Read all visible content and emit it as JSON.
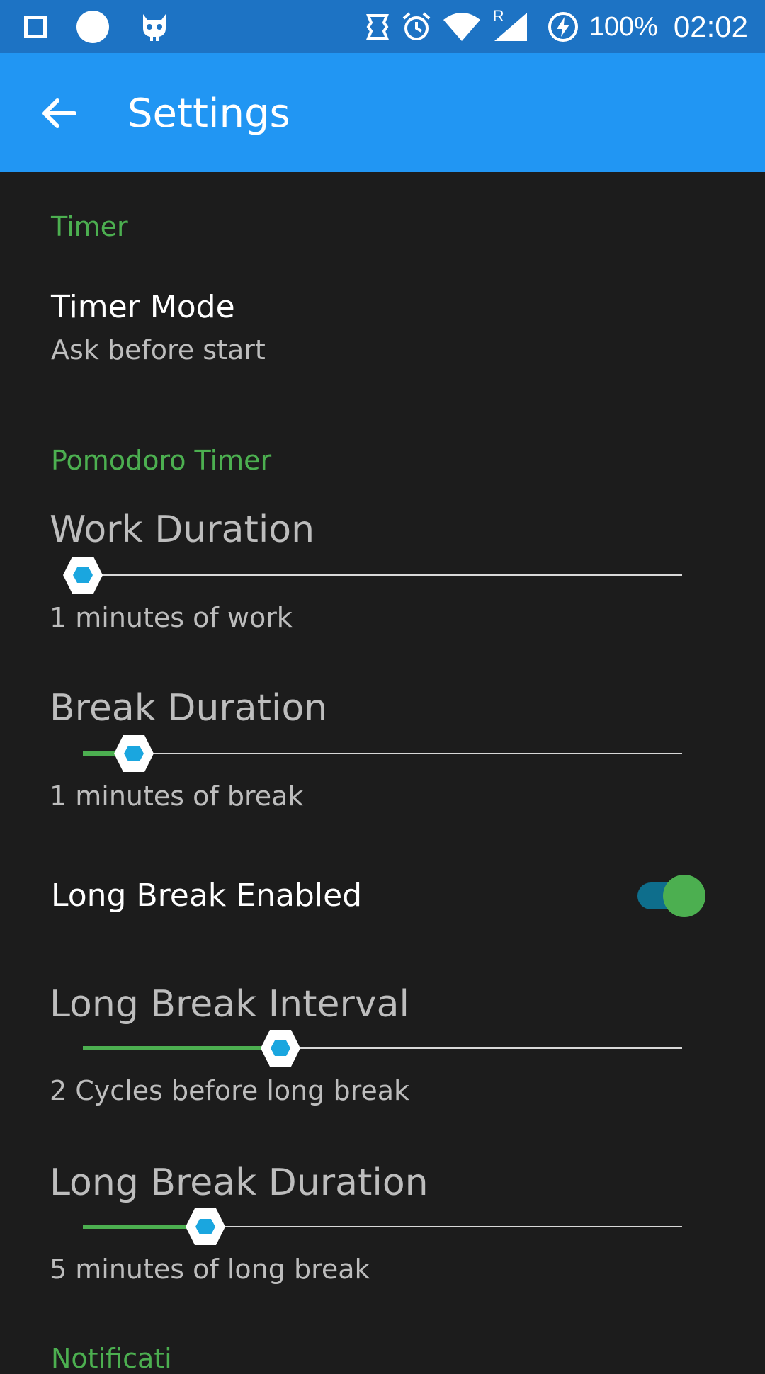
{
  "status_bar": {
    "battery": "100%",
    "time": "02:02",
    "roaming": "R",
    "icons": [
      "square-icon",
      "circle-icon",
      "cyanogen-icon",
      "nfc-icon",
      "alarm-icon",
      "wifi-icon",
      "signal-icon",
      "battery-charging-icon"
    ]
  },
  "app_bar": {
    "title": "Settings",
    "back_icon": "arrow-left-icon"
  },
  "sections": {
    "timer": "Timer",
    "pomodoro": "Pomodoro Timer",
    "notifications": "Notificati"
  },
  "timer_mode": {
    "title": "Timer Mode",
    "summary": "Ask before start"
  },
  "sliders": {
    "work": {
      "title": "Work Duration",
      "summary": "1 minutes of work",
      "fraction": 0.0
    },
    "break": {
      "title": "Break Duration",
      "summary": "1 minutes of break",
      "fraction": 0.085
    },
    "long_interval": {
      "title": "Long Break Interval",
      "summary": "2 Cycles before long break",
      "fraction": 0.33
    },
    "long_duration": {
      "title": "Long Break Duration",
      "summary": "5 minutes of long break",
      "fraction": 0.205
    }
  },
  "long_break_enabled": {
    "title": "Long Break Enabled",
    "checked": true
  },
  "colors": {
    "status_bar": "#1d73c4",
    "app_bar": "#2196f3",
    "accent": "#4caf50",
    "thumb": "#1aa6df",
    "background": "#1c1c1c"
  }
}
